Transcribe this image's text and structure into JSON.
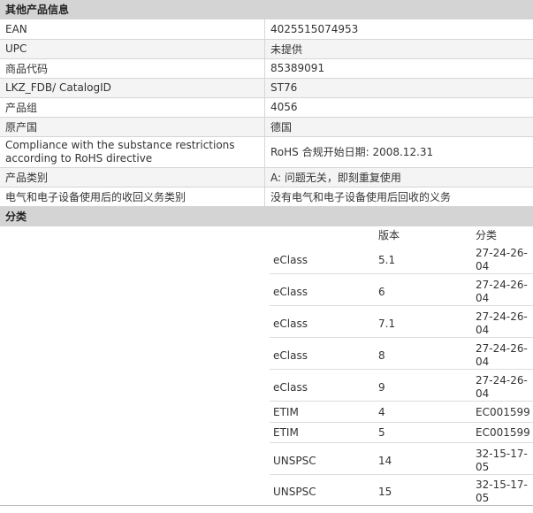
{
  "other_info": {
    "title": "其他产品信息",
    "rows": [
      {
        "label": "EAN",
        "value": "4025515074953"
      },
      {
        "label": "UPC",
        "value": "未提供"
      },
      {
        "label": "商品代码",
        "value": "85389091"
      },
      {
        "label": "LKZ_FDB/ CatalogID",
        "value": "ST76"
      },
      {
        "label": "产品组",
        "value": "4056"
      },
      {
        "label": "原产国",
        "value": "德国"
      },
      {
        "label": "Compliance with the substance restrictions according to RoHS directive",
        "value": "RoHS 合规开始日期: 2008.12.31"
      },
      {
        "label": "产品类别",
        "value": "A: 问题无关，即刻重复使用"
      },
      {
        "label": "电气和电子设备使用后的收回义务类别",
        "value": "没有电气和电子设备使用后回收的义务"
      }
    ]
  },
  "classification": {
    "title": "分类",
    "headers": {
      "version": "版本",
      "class": "分类"
    },
    "rows": [
      {
        "system": "eClass",
        "version": "5.1",
        "class": "27-24-26-04"
      },
      {
        "system": "eClass",
        "version": "6",
        "class": "27-24-26-04"
      },
      {
        "system": "eClass",
        "version": "7.1",
        "class": "27-24-26-04"
      },
      {
        "system": "eClass",
        "version": "8",
        "class": "27-24-26-04"
      },
      {
        "system": "eClass",
        "version": "9",
        "class": "27-24-26-04"
      },
      {
        "system": "ETIM",
        "version": "4",
        "class": "EC001599"
      },
      {
        "system": "ETIM",
        "version": "5",
        "class": "EC001599"
      },
      {
        "system": "UNSPSC",
        "version": "14",
        "class": "32-15-17-05"
      },
      {
        "system": "UNSPSC",
        "version": "15",
        "class": "32-15-17-05"
      }
    ]
  }
}
